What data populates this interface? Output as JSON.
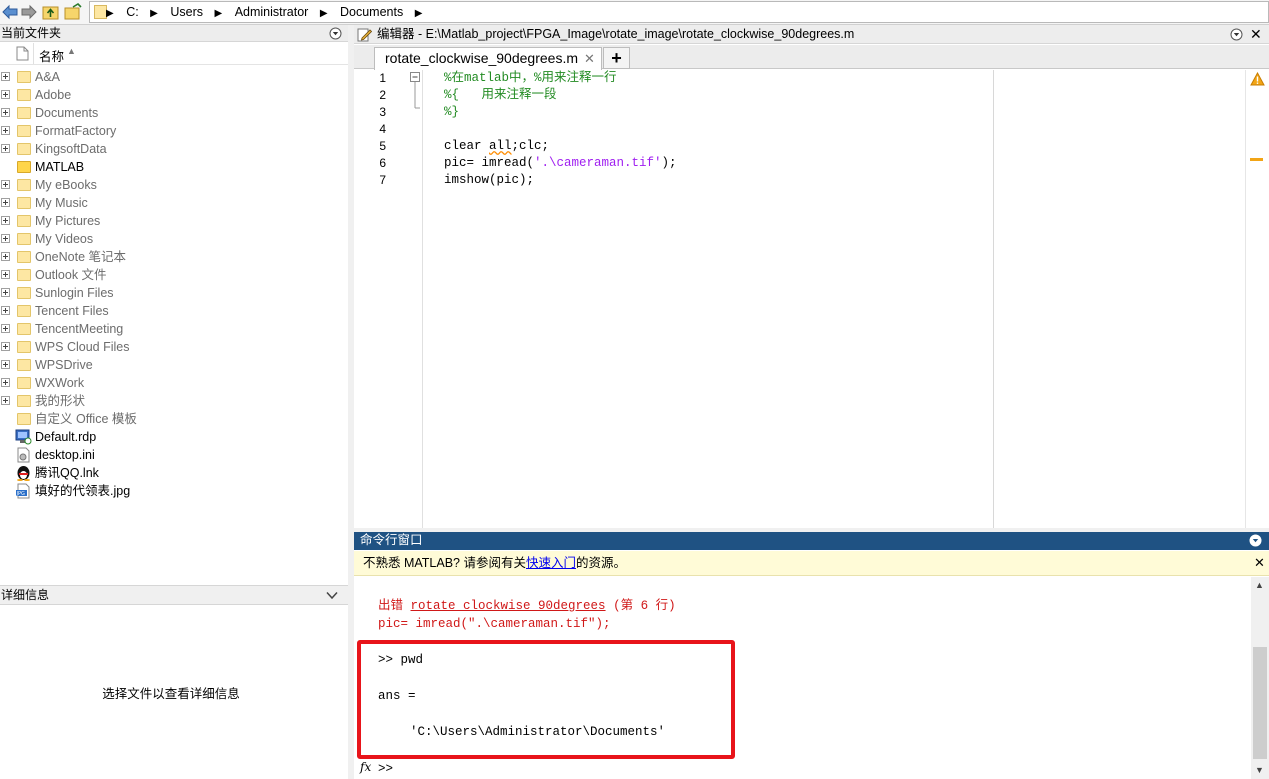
{
  "addressbar": {
    "crumbs": [
      "C:",
      "Users",
      "Administrator",
      "Documents"
    ]
  },
  "filebrowser": {
    "title": "当前文件夹",
    "column_name": "名称",
    "items": [
      {
        "label": "A&A",
        "kind": "folder",
        "expandable": true,
        "dim": true
      },
      {
        "label": "Adobe",
        "kind": "folder",
        "expandable": true,
        "dim": true
      },
      {
        "label": "Documents",
        "kind": "folder",
        "expandable": true,
        "dim": true
      },
      {
        "label": "FormatFactory",
        "kind": "folder",
        "expandable": true,
        "dim": true
      },
      {
        "label": "KingsoftData",
        "kind": "folder",
        "expandable": true,
        "dim": true
      },
      {
        "label": "MATLAB",
        "kind": "folder",
        "expandable": false,
        "dim": false
      },
      {
        "label": "My eBooks",
        "kind": "folder",
        "expandable": true,
        "dim": true
      },
      {
        "label": "My Music",
        "kind": "folder",
        "expandable": true,
        "dim": true
      },
      {
        "label": "My Pictures",
        "kind": "folder",
        "expandable": true,
        "dim": true
      },
      {
        "label": "My Videos",
        "kind": "folder",
        "expandable": true,
        "dim": true
      },
      {
        "label": "OneNote 笔记本",
        "kind": "folder",
        "expandable": true,
        "dim": true
      },
      {
        "label": "Outlook 文件",
        "kind": "folder",
        "expandable": true,
        "dim": true
      },
      {
        "label": "Sunlogin Files",
        "kind": "folder",
        "expandable": true,
        "dim": true
      },
      {
        "label": "Tencent Files",
        "kind": "folder",
        "expandable": true,
        "dim": true
      },
      {
        "label": "TencentMeeting",
        "kind": "folder",
        "expandable": true,
        "dim": true
      },
      {
        "label": "WPS Cloud Files",
        "kind": "folder",
        "expandable": true,
        "dim": true
      },
      {
        "label": "WPSDrive",
        "kind": "folder",
        "expandable": true,
        "dim": true
      },
      {
        "label": "WXWork",
        "kind": "folder",
        "expandable": true,
        "dim": true
      },
      {
        "label": "我的形状",
        "kind": "folder",
        "expandable": true,
        "dim": true
      },
      {
        "label": "自定义 Office 模板",
        "kind": "folder",
        "expandable": false,
        "dim": true
      },
      {
        "label": "Default.rdp",
        "kind": "rdp-file",
        "expandable": false,
        "dim": false
      },
      {
        "label": "desktop.ini",
        "kind": "ini-file",
        "expandable": false,
        "dim": false
      },
      {
        "label": "腾讯QQ.lnk",
        "kind": "qq-shortcut",
        "expandable": false,
        "dim": false
      },
      {
        "label": "填好的代领表.jpg",
        "kind": "jpg-file",
        "expandable": false,
        "dim": false
      }
    ]
  },
  "details": {
    "title": "详细信息",
    "placeholder": "选择文件以查看详细信息"
  },
  "editor": {
    "title": "编辑器 - E:\\Matlab_project\\FPGA_Image\\rotate_image\\rotate_clockwise_90degrees.m",
    "tab_label": "rotate_clockwise_90degrees.m",
    "tab_add": "+",
    "line_numbers": [
      "1",
      "2",
      "3",
      "4",
      "5",
      "6",
      "7"
    ],
    "lines": {
      "l1": "%在matlab中，%用来注释一行",
      "l2": "%{   用来注释一段",
      "l3": "%}",
      "l5_a": "clear ",
      "l5_b": "all",
      "l5_c": ";clc;",
      "l6_a": "pic= imread(",
      "l6_b": "'.\\cameraman.tif'",
      "l6_c": ");",
      "l7": "imshow(pic);"
    }
  },
  "command_window": {
    "title": "命令行窗口",
    "notice_prefix": "不熟悉 MATLAB? 请参阅有关",
    "notice_link": "快速入门",
    "notice_suffix": "的资源。",
    "error_prefix": "出错 ",
    "error_link": "rotate_clockwise_90degrees",
    "error_suffix": " (第 6 行)",
    "error_line": "pic= imread(\".\\cameraman.tif\");",
    "cmd_pwd": ">> pwd",
    "ans_label": "ans =",
    "ans_value": "'C:\\Users\\Administrator\\Documents'",
    "prompt": ">>",
    "fx": "fx"
  },
  "colors": {
    "command_title_bg": "#1f5283",
    "highlight_box": "#e8141a",
    "comment": "#228b22",
    "string": "#a020f0",
    "error": "#d01818"
  }
}
